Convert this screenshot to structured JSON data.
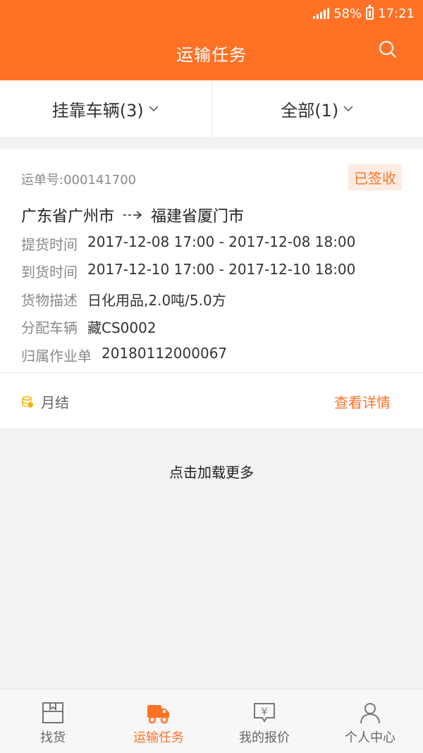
{
  "status_bar": {
    "battery": "58%",
    "time": "17:21"
  },
  "header": {
    "title": "运输任务",
    "search_icon": "search-icon"
  },
  "filters": [
    {
      "label": "挂靠车辆(3)"
    },
    {
      "label": "全部(1)"
    }
  ],
  "order": {
    "order_no": "运单号:000141700",
    "status": "已签收",
    "origin": "广东省广州市",
    "destination": "福建省厦门市",
    "rows": [
      {
        "label": "提货时间",
        "value": "2017-12-08 17:00 - 2017-12-08 18:00"
      },
      {
        "label": "到货时间",
        "value": "2017-12-10 17:00 - 2017-12-10 18:00"
      },
      {
        "label": "货物描述",
        "value": "日化用品,2.0吨/5.0方"
      },
      {
        "label": "分配车辆",
        "value": "藏CS0002"
      },
      {
        "label": "归属作业单",
        "value": "20180112000067"
      }
    ],
    "payment": "月结",
    "details_link": "查看详情"
  },
  "load_more": "点击加载更多",
  "nav": [
    {
      "label": "找货",
      "icon": "box-icon"
    },
    {
      "label": "运输任务",
      "icon": "truck-icon"
    },
    {
      "label": "我的报价",
      "icon": "quote-icon"
    },
    {
      "label": "个人中心",
      "icon": "user-icon"
    }
  ],
  "colors": {
    "accent": "#ff7226",
    "background": "#f2f2f2"
  }
}
